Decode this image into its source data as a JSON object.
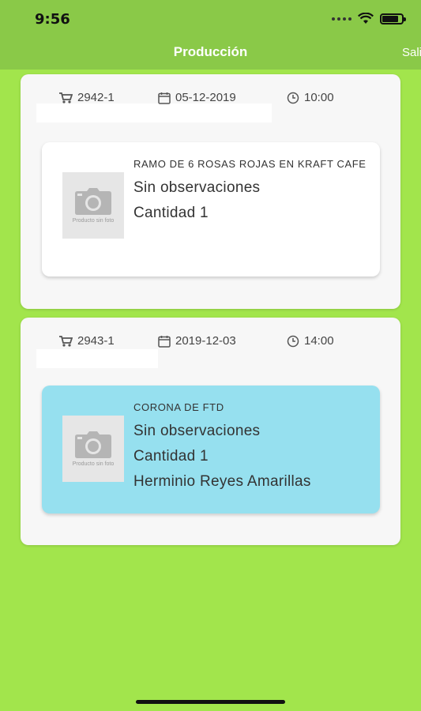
{
  "status_bar": {
    "time": "9:56"
  },
  "nav": {
    "title": "Producción",
    "exit_label": "Salir"
  },
  "orders": [
    {
      "order_id": "2942-1",
      "date": "05-12-2019",
      "time": "10:00",
      "product": {
        "name": "RAMO DE 6 ROSAS ROJAS EN KRAFT CAFE",
        "notes": "Sin observaciones",
        "quantity": "Cantidad 1",
        "photo_caption": "Producto sin foto",
        "background": "#ffffff"
      }
    },
    {
      "order_id": "2943-1",
      "date": "2019-12-03",
      "time": "14:00",
      "product": {
        "name": "CORONA DE FTD",
        "notes": "Sin observaciones",
        "quantity": "Cantidad 1",
        "assignee": "Herminio Reyes Amarillas",
        "photo_caption": "Producto sin foto",
        "background": "#96e0ef"
      }
    }
  ],
  "colors": {
    "page_bg": "#a2e54c",
    "header_bg": "#8ac948",
    "highlight": "#96e0ef"
  }
}
